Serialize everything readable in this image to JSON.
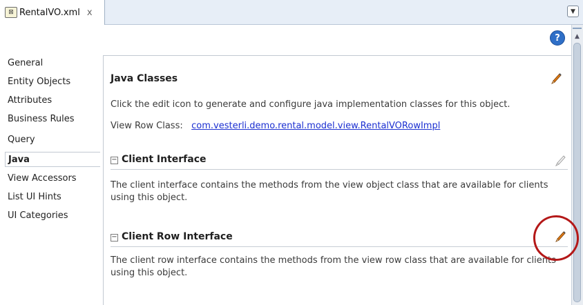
{
  "tab": {
    "label": "RentalVO.xml",
    "close": "x",
    "icon": "xml-file-icon",
    "menu_icon": "chevron-down-icon"
  },
  "help": {
    "label": "?"
  },
  "nav": {
    "items": [
      "General",
      "Entity Objects",
      "Attributes",
      "Business Rules",
      "Query",
      "Java",
      "View Accessors",
      "List UI Hints",
      "UI Categories"
    ],
    "active": "Java"
  },
  "java_classes": {
    "title": "Java Classes",
    "description": "Click the edit icon to generate and configure java implementation classes for this object.",
    "row_class_label": "View Row Class:",
    "row_class_value": "com.vesterli.demo.rental.model.view.RentalVORowImpl"
  },
  "client_interface": {
    "expander": "−",
    "title": "Client Interface",
    "description_line1": "The client interface contains the methods from the view object class that are available for clients",
    "description_line2": "using this object."
  },
  "client_row_interface": {
    "expander": "−",
    "title": "Client Row Interface",
    "description_line1": "The client row interface contains the methods from the view row class that are available for clients",
    "description_line2": "using this object."
  },
  "colors": {
    "pencil_active": "#e07b16",
    "pencil_disabled": "#9a9a9a",
    "highlight": "#b41818",
    "link": "#1b2fd1"
  }
}
